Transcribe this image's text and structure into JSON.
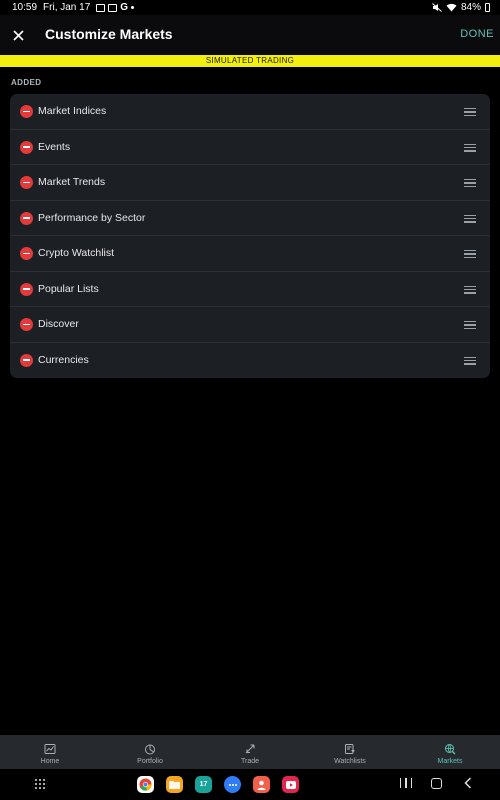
{
  "status_bar": {
    "time": "10:59",
    "date": "Fri, Jan 17",
    "battery": "84%"
  },
  "header": {
    "title": "Customize Markets",
    "close_icon": "close-icon",
    "done_label": "DONE"
  },
  "banner": {
    "text": "SIMULATED TRADING",
    "color": "#f2ee0f"
  },
  "section": {
    "label": "ADDED"
  },
  "markets": {
    "items": [
      {
        "label": "Market Indices"
      },
      {
        "label": "Events"
      },
      {
        "label": "Market Trends"
      },
      {
        "label": "Performance by Sector"
      },
      {
        "label": "Crypto Watchlist"
      },
      {
        "label": "Popular Lists"
      },
      {
        "label": "Discover"
      },
      {
        "label": "Currencies"
      }
    ],
    "remove_icon": "minus-circle-icon",
    "drag_icon": "drag-handle-icon"
  },
  "nav": {
    "items": [
      {
        "label": "Home",
        "icon": "chart-icon"
      },
      {
        "label": "Portfolio",
        "icon": "pie-chart-icon"
      },
      {
        "label": "Trade",
        "icon": "trade-arrows-icon"
      },
      {
        "label": "Watchlists",
        "icon": "watchlist-icon"
      },
      {
        "label": "Markets",
        "icon": "globe-search-icon",
        "active": true
      }
    ],
    "active_color": "#5fc3b6"
  },
  "dock": {
    "apps": [
      "chrome-icon",
      "files-icon",
      "calendar-icon",
      "messages-icon",
      "contacts-icon",
      "youtube-icon"
    ],
    "calendar_day": "17"
  }
}
